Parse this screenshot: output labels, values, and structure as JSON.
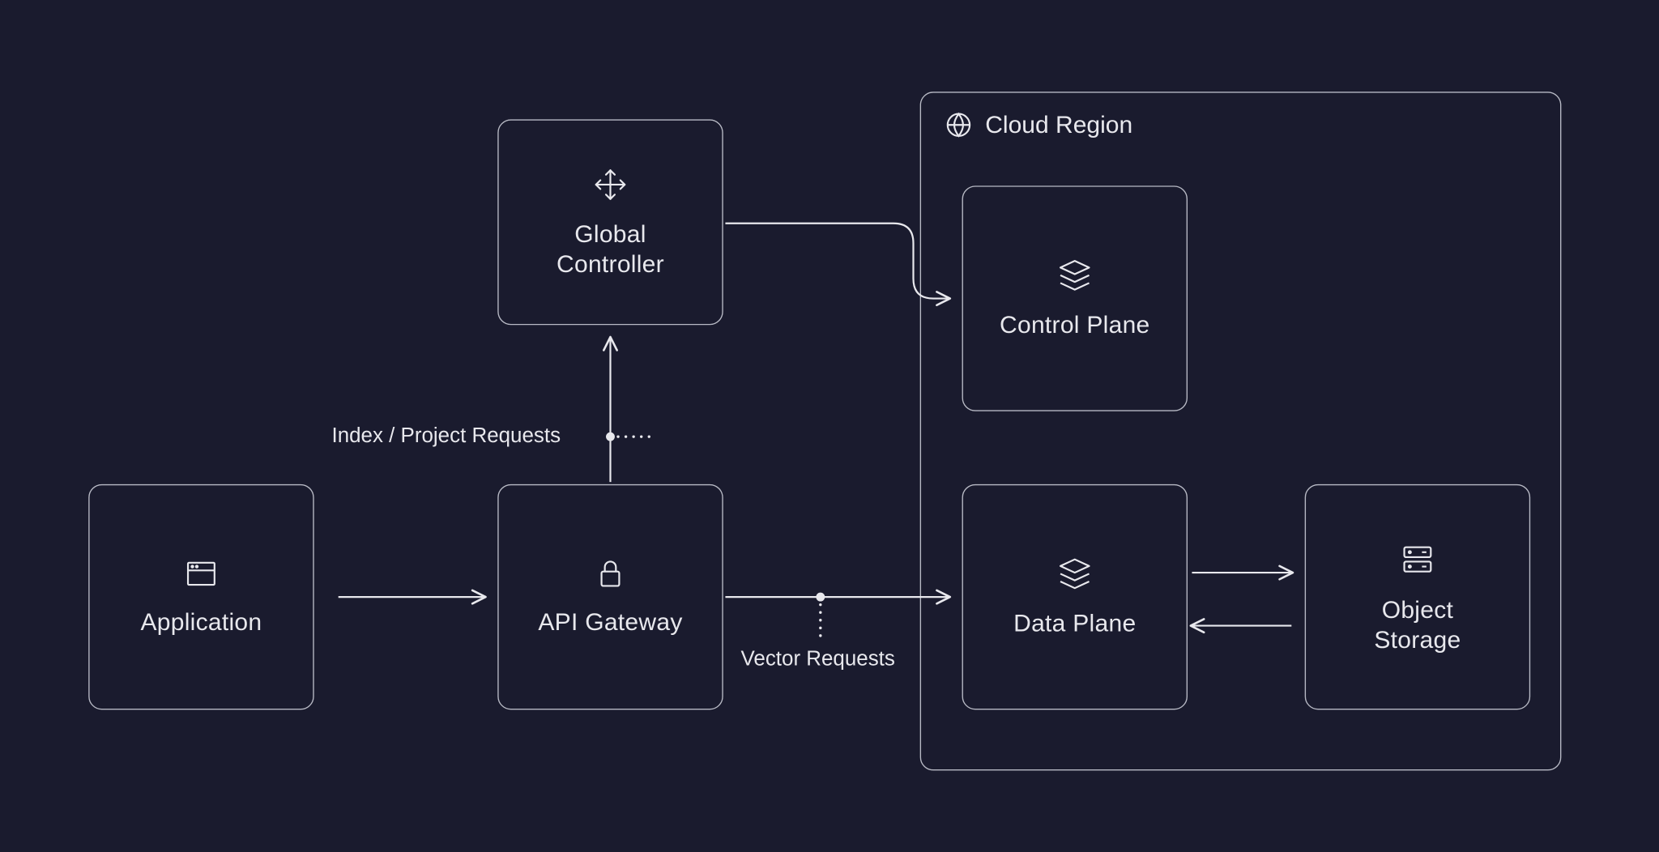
{
  "nodes": {
    "application": "Application",
    "api_gateway": "API Gateway",
    "global_controller": "Global\nController",
    "cloud_region": "Cloud Region",
    "control_plane": "Control Plane",
    "data_plane": "Data Plane",
    "object_storage": "Object\nStorage"
  },
  "edges": {
    "index_project_requests": "Index / Project Requests",
    "vector_requests": "Vector Requests"
  },
  "colors": {
    "background": "#1a1b2e",
    "stroke": "#b8bac5",
    "text": "#e8e8ed"
  }
}
